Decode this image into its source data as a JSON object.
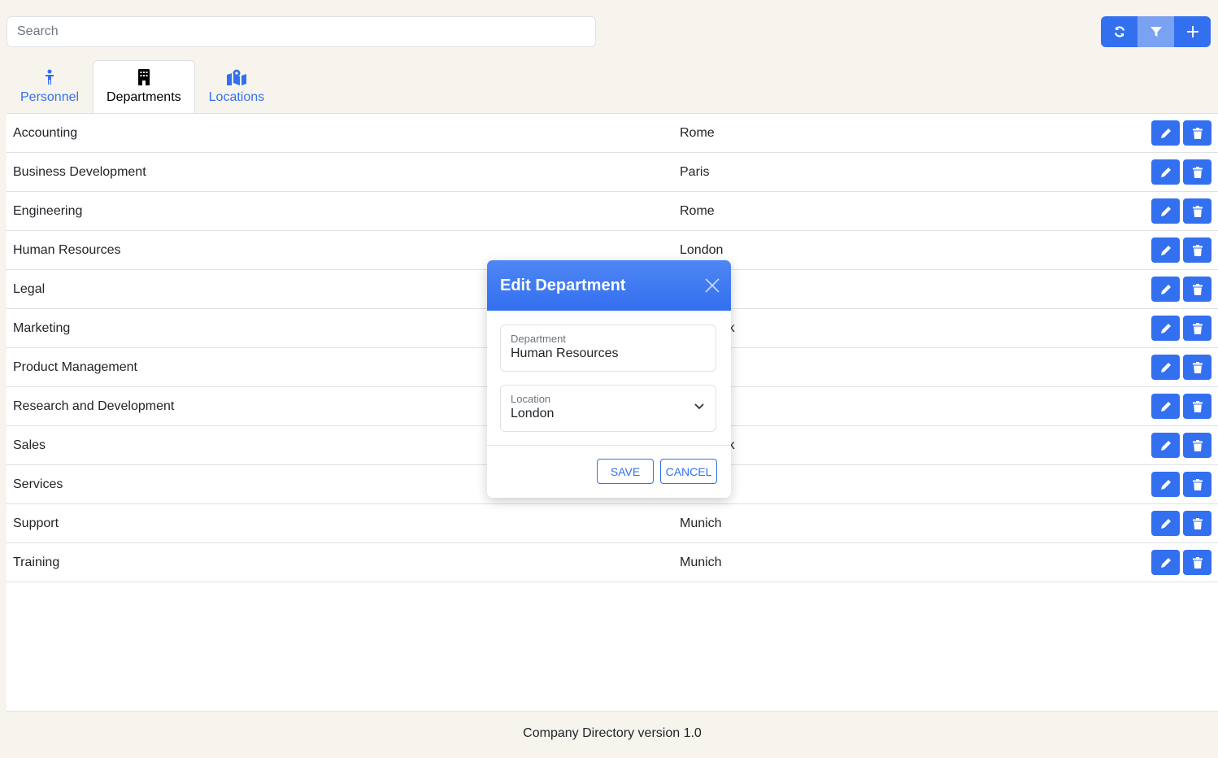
{
  "search": {
    "placeholder": "Search"
  },
  "tabs": [
    {
      "label": "Personnel"
    },
    {
      "label": "Departments"
    },
    {
      "label": "Locations"
    }
  ],
  "departments": [
    {
      "name": "Accounting",
      "location": "Rome"
    },
    {
      "name": "Business Development",
      "location": "Paris"
    },
    {
      "name": "Engineering",
      "location": "Rome"
    },
    {
      "name": "Human Resources",
      "location": "London"
    },
    {
      "name": "Legal",
      "location": ""
    },
    {
      "name": "Marketing",
      "location": "New York"
    },
    {
      "name": "Product Management",
      "location": ""
    },
    {
      "name": "Research and Development",
      "location": ""
    },
    {
      "name": "Sales",
      "location": "New York"
    },
    {
      "name": "Services",
      "location": ""
    },
    {
      "name": "Support",
      "location": "Munich"
    },
    {
      "name": "Training",
      "location": "Munich"
    }
  ],
  "modal": {
    "title": "Edit Department",
    "department_label": "Department",
    "department_value": "Human Resources",
    "location_label": "Location",
    "location_value": "London",
    "save": "SAVE",
    "cancel": "CANCEL"
  },
  "footer": "Company Directory version 1.0",
  "colors": {
    "accent": "#3370f0",
    "background": "#f7f4ee"
  }
}
